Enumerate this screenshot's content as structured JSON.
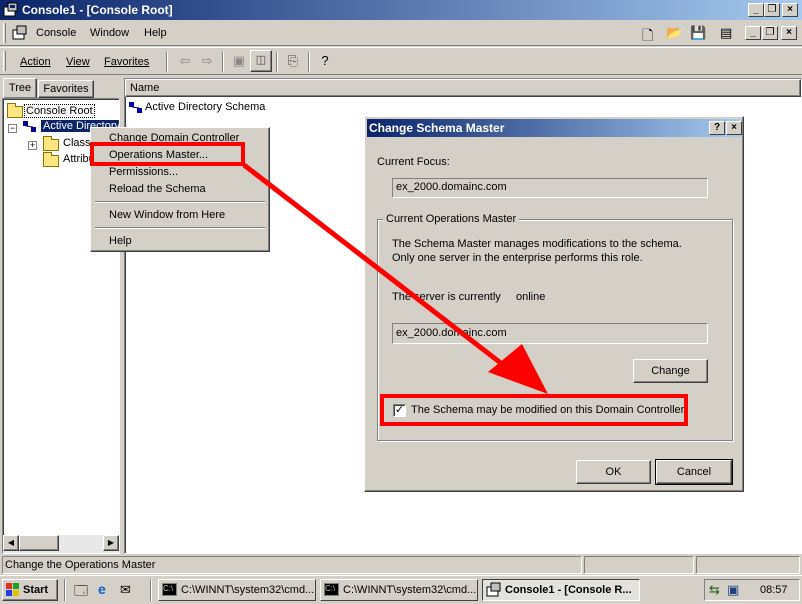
{
  "window": {
    "title": "Console1 - [Console Root]"
  },
  "menubar": {
    "items": [
      "Console",
      "Window",
      "Help"
    ]
  },
  "toolbar": {
    "items": [
      "Action",
      "View",
      "Favorites"
    ]
  },
  "left_pane": {
    "tabs": [
      "Tree",
      "Favorites"
    ],
    "tree": {
      "root": "Console Root",
      "child": "Active Directory",
      "subitems": [
        "Classes",
        "Attributes"
      ]
    }
  },
  "right_pane": {
    "column_header": "Name",
    "items": [
      "Active Directory Schema"
    ]
  },
  "context_menu": {
    "items": [
      "Change Domain Controller",
      "Operations Master...",
      "Permissions...",
      "Reload the Schema",
      "New Window from Here",
      "Help"
    ]
  },
  "dialog": {
    "title": "Change Schema Master",
    "help_button": "?",
    "close_button": "×",
    "current_focus_label": "Current Focus:",
    "current_focus_value": "ex_2000.domainc.com",
    "group_label": "Current Operations Master",
    "description_line1": "The Schema Master manages modifications to the schema.",
    "description_line2": "Only one server in the enterprise performs this role.",
    "server_status_label": "The server is currently",
    "server_status_value": "online",
    "server_value": "ex_2000.domainc.com",
    "change_button": "Change",
    "checkbox_label": "The Schema may be modified on this Domain Controller.",
    "checkbox_checked": true,
    "ok_button": "OK",
    "cancel_button": "Cancel"
  },
  "statusbar": {
    "text": "Change the Operations Master"
  },
  "taskbar": {
    "start": "Start",
    "buttons": [
      "C:\\WINNT\\system32\\cmd...",
      "C:\\WINNT\\system32\\cmd...",
      "Console1 - [Console R..."
    ],
    "clock": "08:57"
  },
  "colors": {
    "title_gradient_start": "#0a246a",
    "title_gradient_end": "#a6caf0",
    "selection": "#0a246a",
    "face": "#d4d0c8",
    "annotation_red": "#ff0000"
  }
}
